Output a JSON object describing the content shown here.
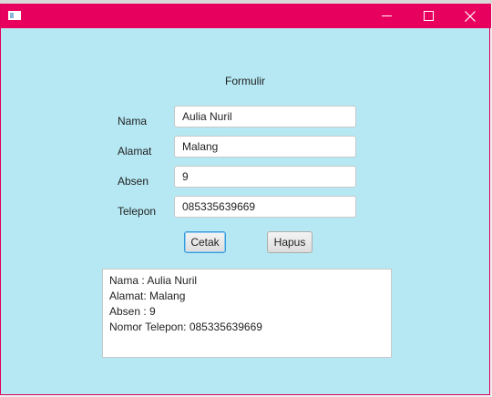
{
  "window": {
    "title_bar_color": "#e8005f",
    "content_bg": "#b5e8f3"
  },
  "form": {
    "title": "Formulir",
    "fields": [
      {
        "label": "Nama",
        "value": "Aulia Nuril"
      },
      {
        "label": "Alamat",
        "value": "Malang"
      },
      {
        "label": "Absen",
        "value": "9"
      },
      {
        "label": "Telepon",
        "value": "085335639669"
      }
    ],
    "buttons": {
      "print_label": "Cetak",
      "clear_label": "Hapus"
    }
  },
  "output": {
    "lines": [
      "Nama : Aulia Nuril",
      "Alamat: Malang",
      "Absen : 9",
      "Nomor Telepon: 085335639669"
    ]
  },
  "icons": {
    "app": "window-icon",
    "minimize": "minimize-icon",
    "maximize": "maximize-icon",
    "close": "close-icon"
  }
}
